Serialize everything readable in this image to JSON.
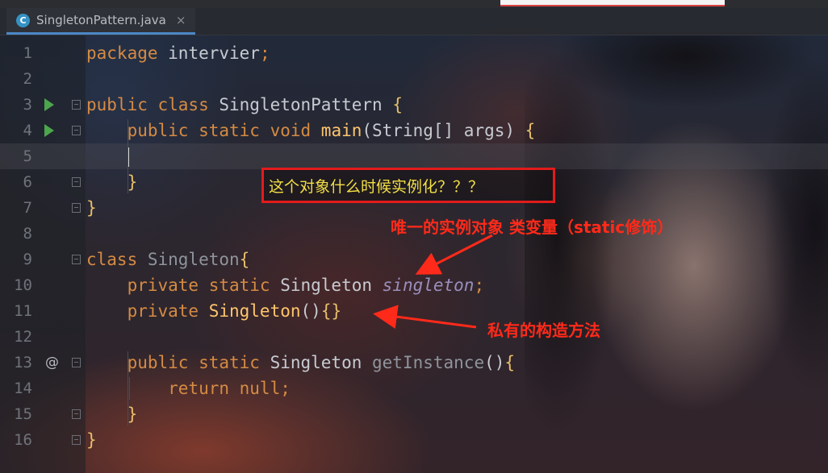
{
  "tab": {
    "label": "SingletonPattern.java",
    "close": "×"
  },
  "lines": [
    {
      "n": "1",
      "code": [
        [
          "kw",
          "package "
        ],
        [
          "plain",
          "intervier"
        ],
        [
          "kw",
          ";"
        ]
      ]
    },
    {
      "n": "2",
      "code": []
    },
    {
      "n": "3",
      "code": [
        [
          "kw",
          "public class "
        ],
        [
          "plain",
          "SingletonPattern "
        ],
        [
          "brace",
          "{"
        ]
      ]
    },
    {
      "n": "4",
      "code": [
        [
          "kw",
          "    public static void "
        ],
        [
          "fn",
          "main"
        ],
        [
          "plain",
          "(String[] args) "
        ],
        [
          "brace",
          "{"
        ]
      ]
    },
    {
      "n": "5",
      "code": []
    },
    {
      "n": "6",
      "code": [
        [
          "brace",
          "    }"
        ]
      ]
    },
    {
      "n": "7",
      "code": [
        [
          "brace",
          "}"
        ]
      ]
    },
    {
      "n": "8",
      "code": []
    },
    {
      "n": "9",
      "code": [
        [
          "kw",
          "class "
        ],
        [
          "dim",
          "Singleton"
        ],
        [
          "brace",
          "{"
        ]
      ]
    },
    {
      "n": "10",
      "code": [
        [
          "kw",
          "    private static "
        ],
        [
          "plain",
          "Singleton "
        ],
        [
          "fld",
          "singleton"
        ],
        [
          "kw",
          ";"
        ]
      ]
    },
    {
      "n": "11",
      "code": [
        [
          "kw",
          "    private "
        ],
        [
          "fn",
          "Singleton"
        ],
        [
          "plain",
          "()"
        ],
        [
          "brace",
          "{}"
        ]
      ]
    },
    {
      "n": "12",
      "code": []
    },
    {
      "n": "13",
      "code": [
        [
          "kw",
          "    public static "
        ],
        [
          "plain",
          "Singleton "
        ],
        [
          "dim",
          "getInstance"
        ],
        [
          "plain",
          "()"
        ],
        [
          "brace",
          "{"
        ]
      ]
    },
    {
      "n": "14",
      "code": [
        [
          "kw",
          "        return null;"
        ]
      ]
    },
    {
      "n": "15",
      "code": [
        [
          "brace",
          "    }"
        ]
      ]
    },
    {
      "n": "16",
      "code": [
        [
          "brace",
          "}"
        ]
      ]
    }
  ],
  "annotations": {
    "question": "这个对象什么时候实例化？？？",
    "field_note": "唯一的实例对象 类变量（static修饰）",
    "ctor_note": "私有的构造方法"
  },
  "gutter_marks": {
    "override": "@"
  },
  "colors": {
    "keyword": "#d58b43",
    "annotation_red": "#e21b1b",
    "note_yellow": "#f3df45",
    "run": "#4ca64c"
  },
  "icons": {
    "tab_class": "java-class-icon",
    "run": "run-icon",
    "fold": "fold-icon",
    "override": "override-icon"
  }
}
